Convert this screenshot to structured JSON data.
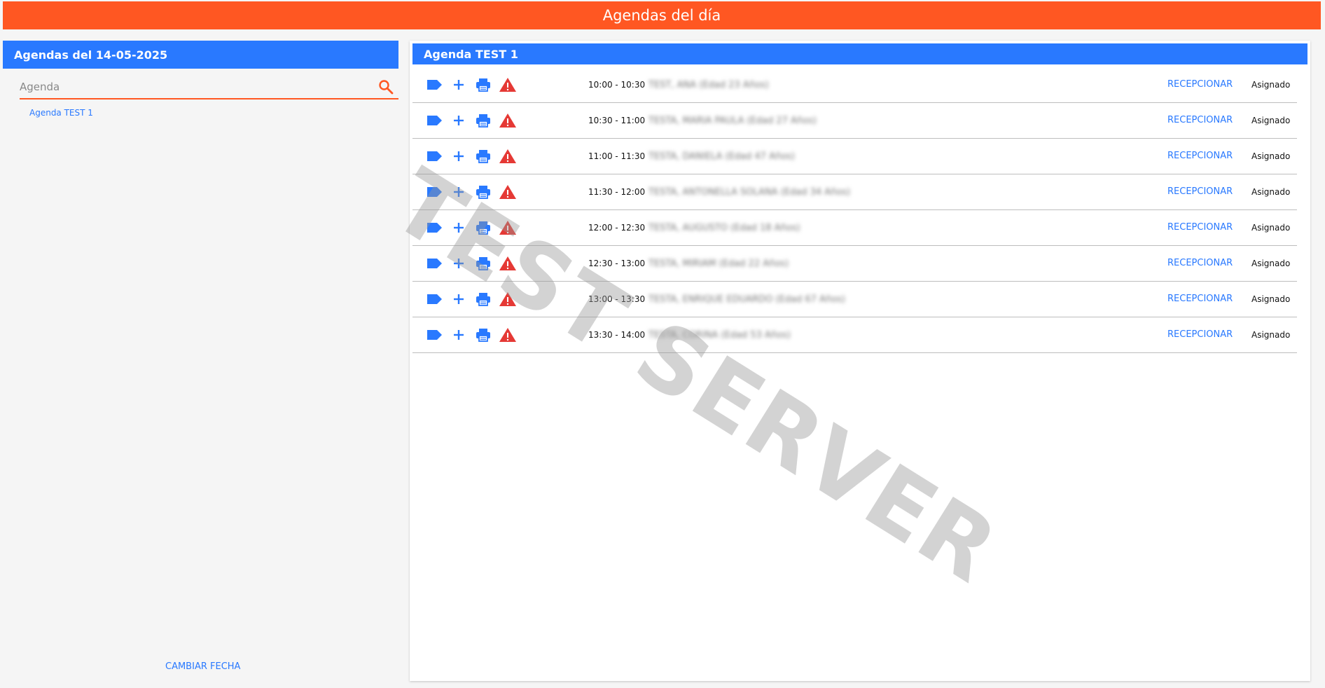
{
  "topbar": {
    "title": "Agendas del día"
  },
  "left": {
    "header": "Agendas del 14-05-2025",
    "search_placeholder": "Agenda",
    "agendas": [
      "Agenda TEST 1"
    ],
    "change_date_label": "CAMBIAR FECHA"
  },
  "right": {
    "header": "Agenda TEST 1",
    "rows": [
      {
        "time": "10:00 - 10:30",
        "patient": "TEST, ANA (Edad 23 Años)",
        "action": "RECEPCIONAR",
        "status": "Asignado"
      },
      {
        "time": "10:30 - 11:00",
        "patient": "TESTA, MARIA PAULA (Edad 27 Años)",
        "action": "RECEPCIONAR",
        "status": "Asignado"
      },
      {
        "time": "11:00 - 11:30",
        "patient": "TESTA, DANIELA (Edad 47 Años)",
        "action": "RECEPCIONAR",
        "status": "Asignado"
      },
      {
        "time": "11:30 - 12:00",
        "patient": "TESTA, ANTONELLA SOLANA (Edad 34 Años)",
        "action": "RECEPCIONAR",
        "status": "Asignado"
      },
      {
        "time": "12:00 - 12:30",
        "patient": "TESTA, AUGUSTO (Edad 18 Años)",
        "action": "RECEPCIONAR",
        "status": "Asignado"
      },
      {
        "time": "12:30 - 13:00",
        "patient": "TESTA, MIRIAM (Edad 22 Años)",
        "action": "RECEPCIONAR",
        "status": "Asignado"
      },
      {
        "time": "13:00 - 13:30",
        "patient": "TESTA, ENRIQUE EDUARDO (Edad 67 Años)",
        "action": "RECEPCIONAR",
        "status": "Asignado"
      },
      {
        "time": "13:30 - 14:00",
        "patient": "TESTA, CORINA (Edad 53 Años)",
        "action": "RECEPCIONAR",
        "status": "Asignado"
      }
    ]
  },
  "watermark": "TEST SERVER",
  "icons": {
    "label": "label-icon",
    "add": "plus-icon",
    "print": "printer-icon",
    "warning": "warning-icon",
    "search": "search-icon"
  },
  "colors": {
    "topbar": "#ff5722",
    "header": "#2979ff",
    "link": "#2979ff",
    "warning": "#e53935"
  }
}
